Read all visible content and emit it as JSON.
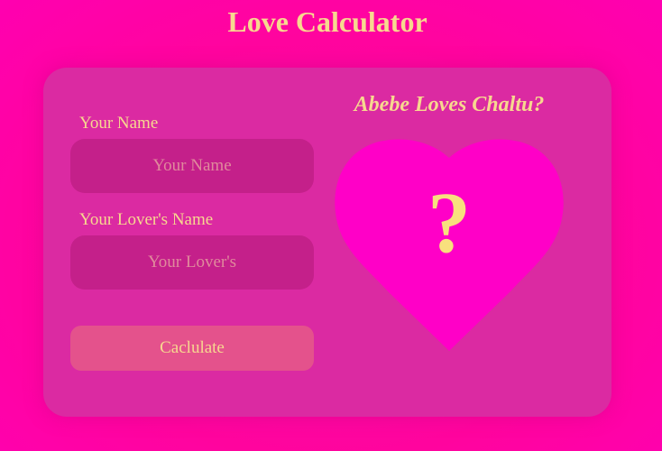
{
  "app": {
    "title": "Love Calculator"
  },
  "form": {
    "your_name_label": "Your Name",
    "your_name_placeholder": "Your Name",
    "your_name_value": "",
    "lover_name_label": "Your Lover's Name",
    "lover_name_placeholder": "Your Lover's",
    "lover_name_value": "",
    "calculate_label": "Caclulate"
  },
  "result": {
    "heading": "Abebe Loves Chaltu?",
    "score_text": "?"
  },
  "colors": {
    "background": "#ff049e",
    "card": "#db2aa2",
    "input_fill": "#c4208a",
    "button_fill": "#e4528c",
    "heart": "#ff00c7",
    "text_gold": "#f7d88f"
  },
  "icons": {
    "heart": "heart-icon"
  }
}
